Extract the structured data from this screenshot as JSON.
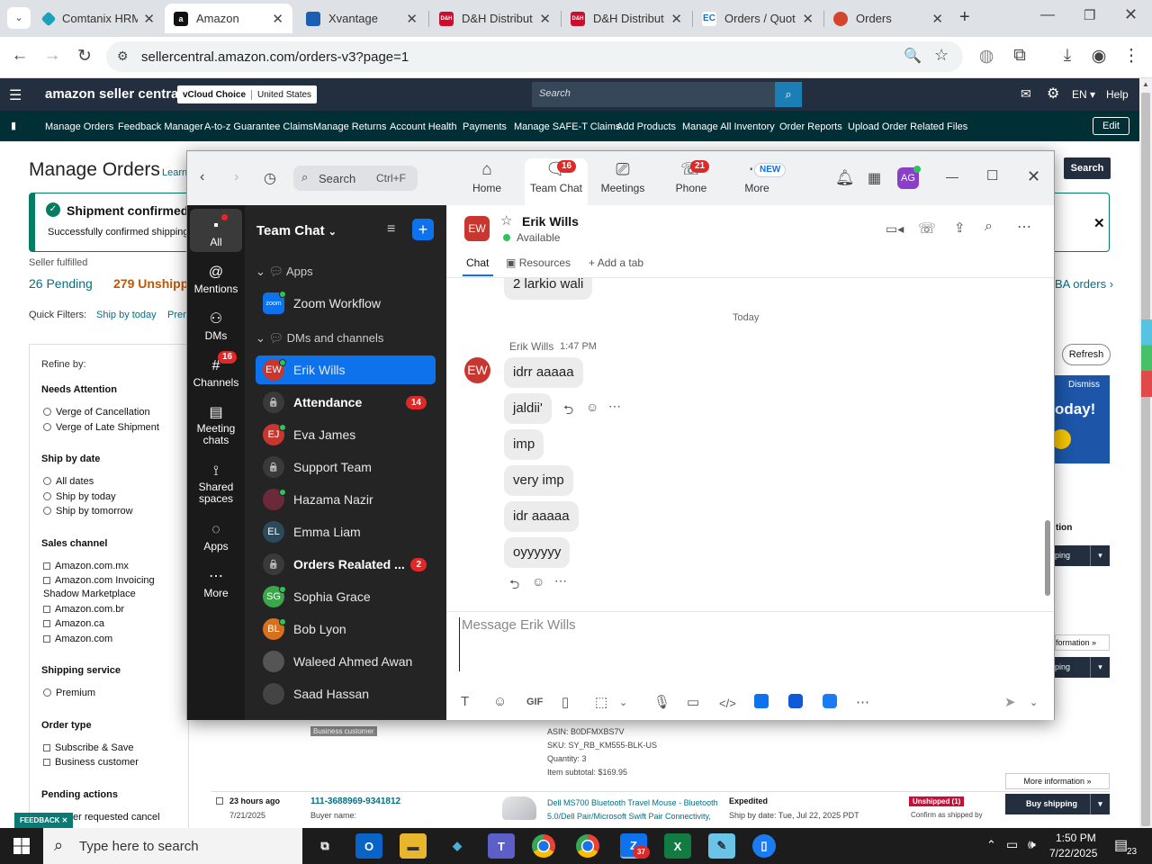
{
  "browser": {
    "tabs": [
      {
        "title": "Comtanix HRM",
        "fav_color": "#1aa3b8",
        "fav_text": ""
      },
      {
        "title": "Amazon",
        "fav_color": "#111111",
        "fav_text": "a"
      },
      {
        "title": "Xvantage",
        "fav_color": "#1a5fb4",
        "fav_text": ""
      },
      {
        "title": "D&H Distribut",
        "fav_color": "#c8102e",
        "fav_text": "D&H"
      },
      {
        "title": "D&H Distribut",
        "fav_color": "#c8102e",
        "fav_text": "D&H"
      },
      {
        "title": "Orders / Quot",
        "fav_color": "#1a6fc4",
        "fav_text": "EC"
      },
      {
        "title": "Orders",
        "fav_color": "#d4442c",
        "fav_text": ""
      }
    ],
    "url": "sellercentral.amazon.com/orders-v3?page=1"
  },
  "amazon": {
    "logo": "amazon seller central",
    "store": "vCloud Choice",
    "region": "United States",
    "search_placeholder": "Search",
    "lang": "EN",
    "help": "Help",
    "nav": [
      "Manage Orders",
      "Feedback Manager",
      "A-to-z Guarantee Claims",
      "Manage Returns",
      "Account Health",
      "Payments",
      "Manage SAFE-T Claims",
      "Add Products",
      "Manage All Inventory",
      "Order Reports",
      "Upload Order Related Files"
    ],
    "edit": "Edit",
    "page_title": "Manage Orders",
    "learn": "Learn",
    "search_btn": "Search",
    "shipment_title": "Shipment confirmed",
    "shipment_text": "Successfully confirmed shipping",
    "seller_fulfilled": "Seller fulfilled",
    "pending": "26 Pending",
    "unshipped": "279 Unshipp",
    "fba_orders": "BA orders",
    "quick_filters": "Quick Filters:",
    "ship_by_today_q": "Ship by today",
    "prem": "Prem",
    "refresh": "Refresh",
    "dismiss": "Dismiss",
    "today_banner": "oday!",
    "refine": "Refine by:",
    "needs_attention": "Needs Attention",
    "verge_cancel": "Verge of Cancellation",
    "verge_late": "Verge of Late Shipment",
    "ship_by_date": "Ship by date",
    "all_dates": "All dates",
    "ship_today": "Ship by today",
    "ship_tomorrow": "Ship by tomorrow",
    "sales_channel": "Sales channel",
    "ch1": "Amazon.com.mx",
    "ch2": "Amazon.com Invoicing",
    "ch2b": "Shadow Marketplace",
    "ch3": "Amazon.com.br",
    "ch4": "Amazon.ca",
    "ch5": "Amazon.com",
    "shipping_service": "Shipping service",
    "premium": "Premium",
    "order_type": "Order type",
    "subscribe": "Subscribe & Save",
    "business": "Business customer",
    "pending_actions": "Pending actions",
    "buyer_cancel": "er requested cancel",
    "feedback": "FEEDBACK",
    "business_badge": "Business customer",
    "asin": "ASIN: B0DFMXBS7V",
    "sku": "SKU: SY_RB_KM555-BLK-US",
    "qty": "Quantity: 3",
    "subtotal": "Item subtotal: $169.95",
    "more_info": "More information",
    "time_ago": "23 hours ago",
    "date": "7/21/2025",
    "order_id": "111-3688969-9341812",
    "buyer_name": "Buyer name:",
    "product": "Dell MS700 Bluetooth Travel Mouse - Bluetooth 5.0/Dell Pair/Microsoft Swift Pair Connectivity,",
    "expedited": "Expedited",
    "ship_by": "Ship by date: Tue, Jul 22, 2025 PDT",
    "unshipped_badge": "Unshipped (1)",
    "confirm_ship": "Confirm as shipped by",
    "buy_shipping": "Buy shipping",
    "ping": "ping",
    "tion": "tion",
    "formation": "formation"
  },
  "zoom": {
    "search": "Search",
    "shortcut": "Ctrl+F",
    "tabs": [
      {
        "label": "Home",
        "icon": "⌂",
        "badge": ""
      },
      {
        "label": "Team Chat",
        "icon": "💬",
        "badge": "16"
      },
      {
        "label": "Meetings",
        "icon": "▭",
        "badge": ""
      },
      {
        "label": "Phone",
        "icon": "☏",
        "badge": "21"
      },
      {
        "label": "More",
        "icon": "⋯",
        "badge": "NEW"
      }
    ],
    "profile_initials": "AG",
    "rail": [
      {
        "label": "All",
        "icon": "▪",
        "badge": ""
      },
      {
        "label": "Mentions",
        "icon": "@",
        "badge": ""
      },
      {
        "label": "DMs",
        "icon": "👥",
        "badge": ""
      },
      {
        "label": "Channels",
        "icon": "#",
        "badge": "16"
      },
      {
        "label": "Meeting chats",
        "icon": "▤",
        "badge": ""
      },
      {
        "label": "Shared spaces",
        "icon": "⟟",
        "badge": ""
      },
      {
        "label": "Apps",
        "icon": "◌",
        "badge": ""
      },
      {
        "label": "More",
        "icon": "⋯",
        "badge": ""
      }
    ],
    "list_title": "Team Chat",
    "section_apps": "Apps",
    "section_dms": "DMs and channels",
    "app_items": [
      {
        "label": "Zoom Workflow"
      }
    ],
    "items": [
      {
        "label": "Erik Wills",
        "initials": "EW",
        "color": "#c7372f",
        "count": "",
        "bold": false,
        "selected": true,
        "online": true
      },
      {
        "label": "Attendance",
        "initials": "🔒",
        "color": "#3a3a3a",
        "count": "14",
        "bold": true,
        "selected": false,
        "online": false
      },
      {
        "label": "Eva James",
        "initials": "EJ",
        "color": "#c7372f",
        "count": "",
        "bold": false,
        "selected": false,
        "online": true
      },
      {
        "label": "Support Team",
        "initials": "🔒",
        "color": "#3a3a3a",
        "count": "",
        "bold": false,
        "selected": false,
        "online": false
      },
      {
        "label": "Hazama Nazir",
        "initials": "",
        "color": "#6a2a3a",
        "count": "",
        "bold": false,
        "selected": false,
        "online": true
      },
      {
        "label": "Emma Liam",
        "initials": "EL",
        "color": "#2b4a5a",
        "count": "",
        "bold": false,
        "selected": false,
        "online": false
      },
      {
        "label": "Orders Realated ...",
        "initials": "🔒",
        "color": "#3a3a3a",
        "count": "2",
        "bold": true,
        "selected": false,
        "online": false
      },
      {
        "label": "Sophia Grace",
        "initials": "SG",
        "color": "#3aa84a",
        "count": "",
        "bold": false,
        "selected": false,
        "online": true
      },
      {
        "label": "Bob Lyon",
        "initials": "BL",
        "color": "#d9711c",
        "count": "",
        "bold": false,
        "selected": false,
        "online": true
      },
      {
        "label": "Waleed Ahmed Awan",
        "initials": "",
        "color": "#555555",
        "count": "",
        "bold": false,
        "selected": false,
        "online": false
      },
      {
        "label": "Saad Hassan",
        "initials": "",
        "color": "#444444",
        "count": "",
        "bold": false,
        "selected": false,
        "online": false
      }
    ],
    "chat": {
      "name": "Erik Wills",
      "initials": "EW",
      "status": "Available",
      "tab_chat": "Chat",
      "tab_resources": "Resources",
      "tab_add": "Add a tab",
      "prev_message": "2 larkio wali",
      "day": "Today",
      "sender": "Erik Wills",
      "time": "1:47 PM",
      "messages": [
        "idrr aaaaa",
        "jaldii'",
        "imp",
        "very imp",
        "idr aaaaa",
        "oyyyyyy"
      ],
      "placeholder": "Message Erik Wills",
      "gif": "GIF"
    }
  },
  "taskbar": {
    "search": "Type here to search",
    "time": "1:50 PM",
    "date": "7/22/2025",
    "notif": "23",
    "teams_badge": "37"
  }
}
